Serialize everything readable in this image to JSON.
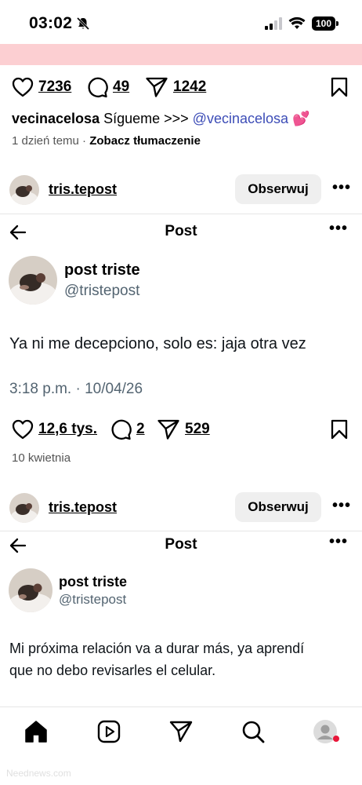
{
  "status_bar": {
    "time": "03:02",
    "battery": "100"
  },
  "colors": {
    "pink_strip": "#fccfd2",
    "mention": "#3d4db7",
    "handle_gray": "#536471",
    "notification_dot": "#e8173a"
  },
  "post_actions": {
    "likes": "7236",
    "comments": "49",
    "shares": "1242"
  },
  "caption": {
    "username": "vecinacelosa",
    "text": " Sígueme >>> ",
    "mention": "@vecinacelosa",
    "emoji": " 💕"
  },
  "post_meta": {
    "time_ago": "1 dzień temu",
    "separator": " · ",
    "translate": "Zobacz tłumaczenie"
  },
  "posts": [
    {
      "username": "tris.tepost",
      "follow_label": "Obserwuj",
      "more": "•••",
      "screenshot": {
        "nav_title": "Post",
        "more": "•••",
        "display_name": "post triste",
        "handle": "@tristepost",
        "text": "Ya ni me decepciono, solo es: jaja otra vez",
        "timestamp": "3:18 p.m. · 10/04/26"
      },
      "actions": {
        "likes": "12,6 tys.",
        "comments": "2",
        "shares": "529"
      },
      "date": "10 kwietnia"
    },
    {
      "username": "tris.tepost",
      "follow_label": "Obserwuj",
      "more": "•••",
      "screenshot": {
        "nav_title": "Post",
        "more": "•••",
        "display_name": "post triste",
        "handle": "@tristepost",
        "text_line1": "Mi próxima relación va a durar más, ya aprendí",
        "text_line2": "que no debo revisarles el celular."
      }
    }
  ],
  "bottom_nav": {
    "items": [
      "home-icon",
      "reels-icon",
      "send-icon",
      "search-icon",
      "profile-icon"
    ]
  },
  "watermark": "Neednews.com"
}
